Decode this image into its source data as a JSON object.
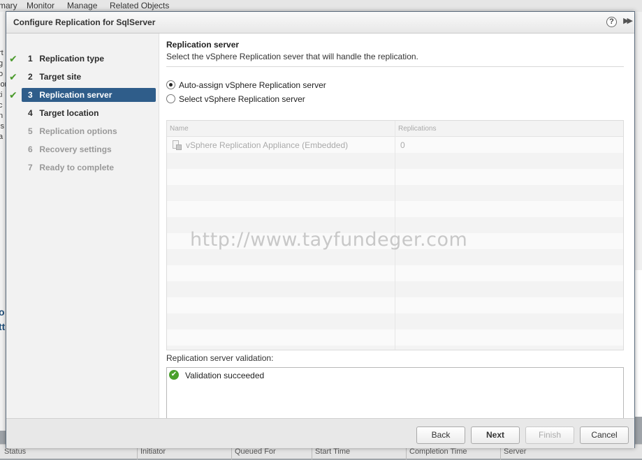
{
  "background": {
    "tabs": [
      "mary",
      "Monitor",
      "Manage",
      "Related Objects"
    ],
    "left_fragments": [
      "rt",
      "g",
      "o",
      "ior",
      "ti",
      "c",
      "n",
      "is",
      "a"
    ],
    "left_blue": [
      "o",
      "tt"
    ],
    "footer_columns": [
      "Status",
      "Initiator",
      "Queued For",
      "Start Time",
      "Completion Time",
      "Server"
    ]
  },
  "dialog": {
    "title": "Configure Replication for SqlServer",
    "help_glyph": "?",
    "expand_glyph": "▶▶"
  },
  "steps": [
    {
      "num": "1",
      "label": "Replication type",
      "state": "done"
    },
    {
      "num": "2",
      "label": "Target site",
      "state": "done"
    },
    {
      "num": "3",
      "label": "Replication server",
      "state": "active"
    },
    {
      "num": "4",
      "label": "Target location",
      "state": "todo"
    },
    {
      "num": "5",
      "label": "Replication options",
      "state": "pending"
    },
    {
      "num": "6",
      "label": "Recovery settings",
      "state": "pending"
    },
    {
      "num": "7",
      "label": "Ready to complete",
      "state": "pending"
    }
  ],
  "content": {
    "title": "Replication server",
    "description": "Select the vSphere Replication sever that will handle the replication.",
    "radio_auto": "Auto-assign vSphere Replication server",
    "radio_select": "Select vSphere Replication server",
    "selected_option": "auto",
    "grid": {
      "columns": [
        "Name",
        "Replications"
      ],
      "rows": [
        {
          "name": "vSphere Replication Appliance (Embedded)",
          "replications": "0",
          "icon": "server-icon"
        }
      ]
    },
    "watermark": "http://www.tayfundeger.com",
    "validation_label": "Replication server validation:",
    "validation_message": "Validation succeeded",
    "validation_icon": "check-circle-icon"
  },
  "buttons": {
    "back": "Back",
    "next": "Next",
    "finish": "Finish",
    "cancel": "Cancel"
  },
  "colors": {
    "active_step": "#2f5d8a",
    "check": "#4a9a2b"
  }
}
